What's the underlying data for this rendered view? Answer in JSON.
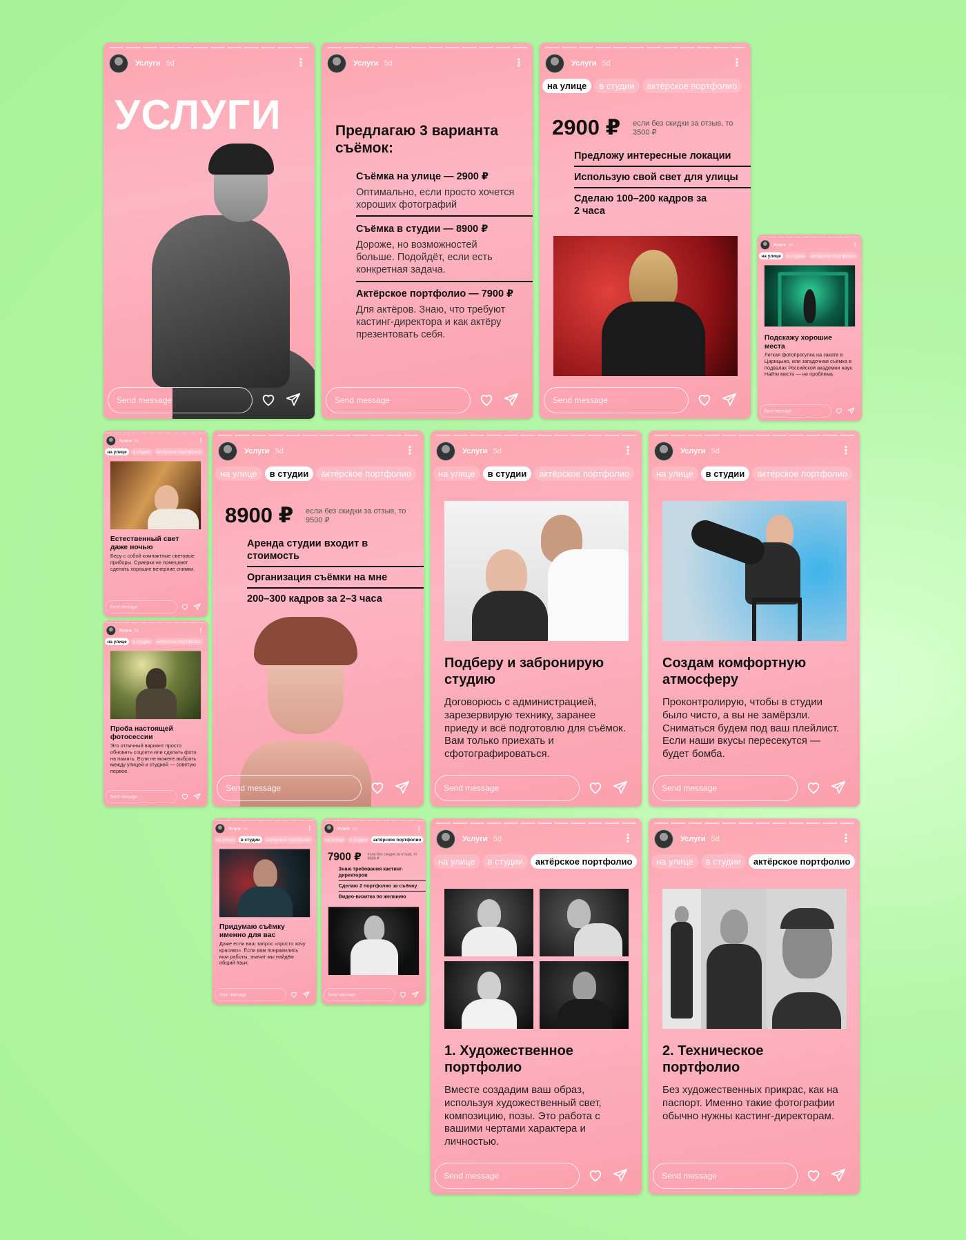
{
  "story": {
    "username": "Услуги",
    "time": "5d",
    "send_placeholder": "Send message"
  },
  "tabs": {
    "street": "на улице",
    "studio": "в студии",
    "actor": "актёрское портфолио"
  },
  "cover": {
    "title": "УСЛУГИ"
  },
  "options": {
    "heading": "Предлагаю 3 варианта съёмок:",
    "items": [
      {
        "title": "Съёмка на улице — 2900 ₽",
        "desc": "Оптимально, если просто хочется хороших фотографий"
      },
      {
        "title": "Съёмка в студии — 8900 ₽",
        "desc": "Дороже, но возможностей больше. Подойдёт, если есть конкретная задача."
      },
      {
        "title": "Актёрское портфолио — 7900 ₽",
        "desc": "Для актёров. Знаю, что требуют кастинг-директора и как актёру презентовать себя."
      }
    ]
  },
  "street": {
    "price": "2900 ₽",
    "price_note": "если без скидки за отзыв, то 3500 ₽",
    "features": [
      "Предложу интересные локации",
      "Использую свой свет для улицы",
      "Сделаю 100–200 кадров за 2 часа"
    ]
  },
  "places": {
    "title": "Подскажу хорошие места",
    "text": "Легкая фотопрогулка на закате в Царицыно, или загадочная съёмка в подвалах Российской академии наук. Найти место — не проблема."
  },
  "nightlight": {
    "title": "Естественный свет даже ночью",
    "text": "Беру с собой компактные световые приборы. Сумерки не помешают сделать хорошие вечерние снимки."
  },
  "trial": {
    "title": "Проба настоящей фотосессии",
    "text": "Это отличный вариант просто обновить соцсети или сделать фото на память. Если не можете выбрать между улицей и студией — советую первое."
  },
  "studio": {
    "price": "8900 ₽",
    "price_note": "если без скидки за отзыв, то 9500 ₽",
    "features": [
      "Аренда студии входит в стоимость",
      "Организация съёмки на мне",
      "200–300 кадров за 2–3 часа"
    ]
  },
  "booking": {
    "title": "Подберу и забронирую студию",
    "text": "Договорюсь с администрацией, зарезервирую технику, заранее приеду и всё подготовлю для съёмок. Вам только приехать и сфотографироваться."
  },
  "comfort": {
    "title": "Создам комфортную атмосферу",
    "text": "Проконтролирую, чтобы в студии было чисто, а вы не замёрзли. Сниматься будем под ваш плейлист. Если наши вкусы пересекутся — будет бомба."
  },
  "concept": {
    "title": "Придумаю съёмку именно для вас",
    "text": "Даже если ваш запрос «просто хочу красиво». Если вам понравились мои работы, значит мы найдём общий язык."
  },
  "actor": {
    "price": "7900 ₽",
    "price_note": "если без скидки за отзыв, то 8500 ₽",
    "features": [
      "Знаю требования кастинг-директоров",
      "Сделаю 2 портфолио за съёмку",
      "Видео-визитка по желанию"
    ]
  },
  "art": {
    "title": "1. Художественное портфолио",
    "text": "Вместе создадим ваш образ, используя художественный свет, композицию, позы. Это работа с вашими чертами характера и личностью."
  },
  "tech": {
    "title": "2. Техническое портфолио",
    "text": "Без художественных прикрас, как на паспорт. Именно такие фотографии обычно нужны кастинг-директорам."
  },
  "icons": [
    "avatar",
    "more-icon",
    "heart-icon",
    "send-icon"
  ],
  "colors": {
    "background": "#a8f39a",
    "card": "#fda6b0",
    "text": "#111111"
  }
}
